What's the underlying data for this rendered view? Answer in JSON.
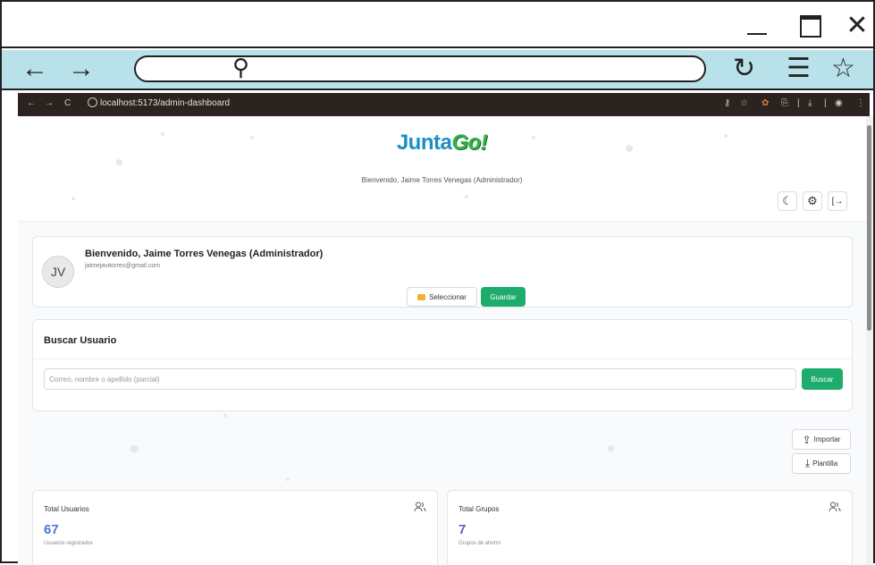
{
  "window": {
    "minimize_icon": "minimize-icon",
    "maximize_icon": "maximize-icon",
    "close_glyph": "✕"
  },
  "outer_nav": {
    "back_glyph": "←",
    "forward_glyph": "→",
    "search_glyph": "⚲",
    "reload_glyph": "↻",
    "menu_glyph": "☰",
    "star_glyph": "☆"
  },
  "inner_browser": {
    "url": "localhost:5173/admin-dashboard",
    "back_glyph": "←",
    "forward_glyph": "→",
    "reload_glyph": "C",
    "right_icons": [
      "⚷",
      "☆",
      "✿",
      "⎘",
      "|",
      "⤓",
      "|",
      "◉",
      "⋮"
    ]
  },
  "hero": {
    "logo_part1": "Junta",
    "logo_part2": "Go!",
    "subtitle": "Bienvenido, Jaime Torres Venegas (Administrador)",
    "icons": [
      {
        "name": "theme-moon-icon",
        "glyph": "☾"
      },
      {
        "name": "settings-gear-icon",
        "glyph": "⚙"
      },
      {
        "name": "logout-icon",
        "glyph": "[→"
      }
    ]
  },
  "profile": {
    "initials": "JV",
    "name": "Bienvenido, Jaime Torres Venegas (Administrador)",
    "email": "jaimejavitorres@gmail.com",
    "select_label": "Seleccionar",
    "save_label": "Guardar"
  },
  "search": {
    "title": "Buscar Usuario",
    "placeholder": "Correo, nombre o apellido (parcial)",
    "button_label": "Buscar"
  },
  "actions": {
    "import_label": "Importar",
    "import_glyph": "⇪",
    "template_label": "Plantilla",
    "template_glyph": "⤓"
  },
  "stats": [
    {
      "title": "Total Usuarios",
      "value": "67",
      "desc": "Usuarios registrados",
      "color": "#4a7bd1",
      "icon": "users-icon"
    },
    {
      "title": "Total Grupos",
      "value": "7",
      "desc": "Grupos de ahorro",
      "color": "#7c4dc4",
      "icon": "users-icon"
    }
  ],
  "colors": {
    "accent_green": "#1eac6d",
    "nav_bg": "#b9e1ea",
    "inner_bar_bg": "#2b2320"
  }
}
